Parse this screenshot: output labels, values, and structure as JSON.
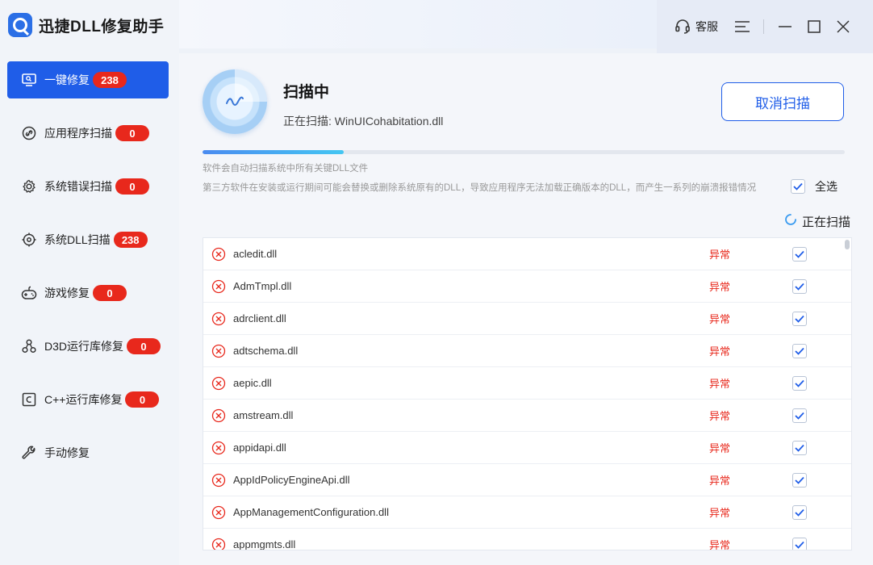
{
  "app": {
    "title": "迅捷DLL修复助手",
    "accent_color": "#1f5de8",
    "error_color": "#e8281c"
  },
  "sidebar": {
    "items": [
      {
        "label": "一键修复",
        "badge": "238",
        "icon": "monitor-icon",
        "active": true
      },
      {
        "label": "应用程序扫描",
        "badge": "0",
        "icon": "link-icon"
      },
      {
        "label": "系统错误扫描",
        "badge": "0",
        "icon": "gear-icon"
      },
      {
        "label": "系统DLL扫描",
        "badge": "238",
        "icon": "target-icon"
      },
      {
        "label": "游戏修复",
        "badge": "0",
        "icon": "gamepad-icon"
      },
      {
        "label": "D3D运行库修复",
        "badge": "0",
        "icon": "nodes-icon"
      },
      {
        "label": "C++运行库修复",
        "badge": "0",
        "icon": "c-box-icon"
      },
      {
        "label": "手动修复",
        "icon": "wrench-icon"
      }
    ]
  },
  "titlebar": {
    "service_label": "客服"
  },
  "scan": {
    "title": "扫描中",
    "current_file": "正在扫描: WinUICohabitation.dll",
    "cancel_label": "取消扫描",
    "progress": 0.22,
    "desc1": "软件会自动扫描系统中所有关键DLL文件",
    "desc2": "第三方软件在安装或运行期间可能会替换或删除系统原有的DLL，导致应用程序无法加载正确版本的DLL，而产生一系列的崩溃报错情况",
    "select_all_label": "全选",
    "status_label": "正在扫描"
  },
  "files": [
    {
      "name": "acledit.dll",
      "status": "异常",
      "checked": true
    },
    {
      "name": "AdmTmpl.dll",
      "status": "异常",
      "checked": true
    },
    {
      "name": "adrclient.dll",
      "status": "异常",
      "checked": true
    },
    {
      "name": "adtschema.dll",
      "status": "异常",
      "checked": true
    },
    {
      "name": "aepic.dll",
      "status": "异常",
      "checked": true
    },
    {
      "name": "amstream.dll",
      "status": "异常",
      "checked": true
    },
    {
      "name": "appidapi.dll",
      "status": "异常",
      "checked": true
    },
    {
      "name": "AppIdPolicyEngineApi.dll",
      "status": "异常",
      "checked": true
    },
    {
      "name": "AppManagementConfiguration.dll",
      "status": "异常",
      "checked": true
    },
    {
      "name": "appmgmts.dll",
      "status": "异常",
      "checked": true
    }
  ]
}
